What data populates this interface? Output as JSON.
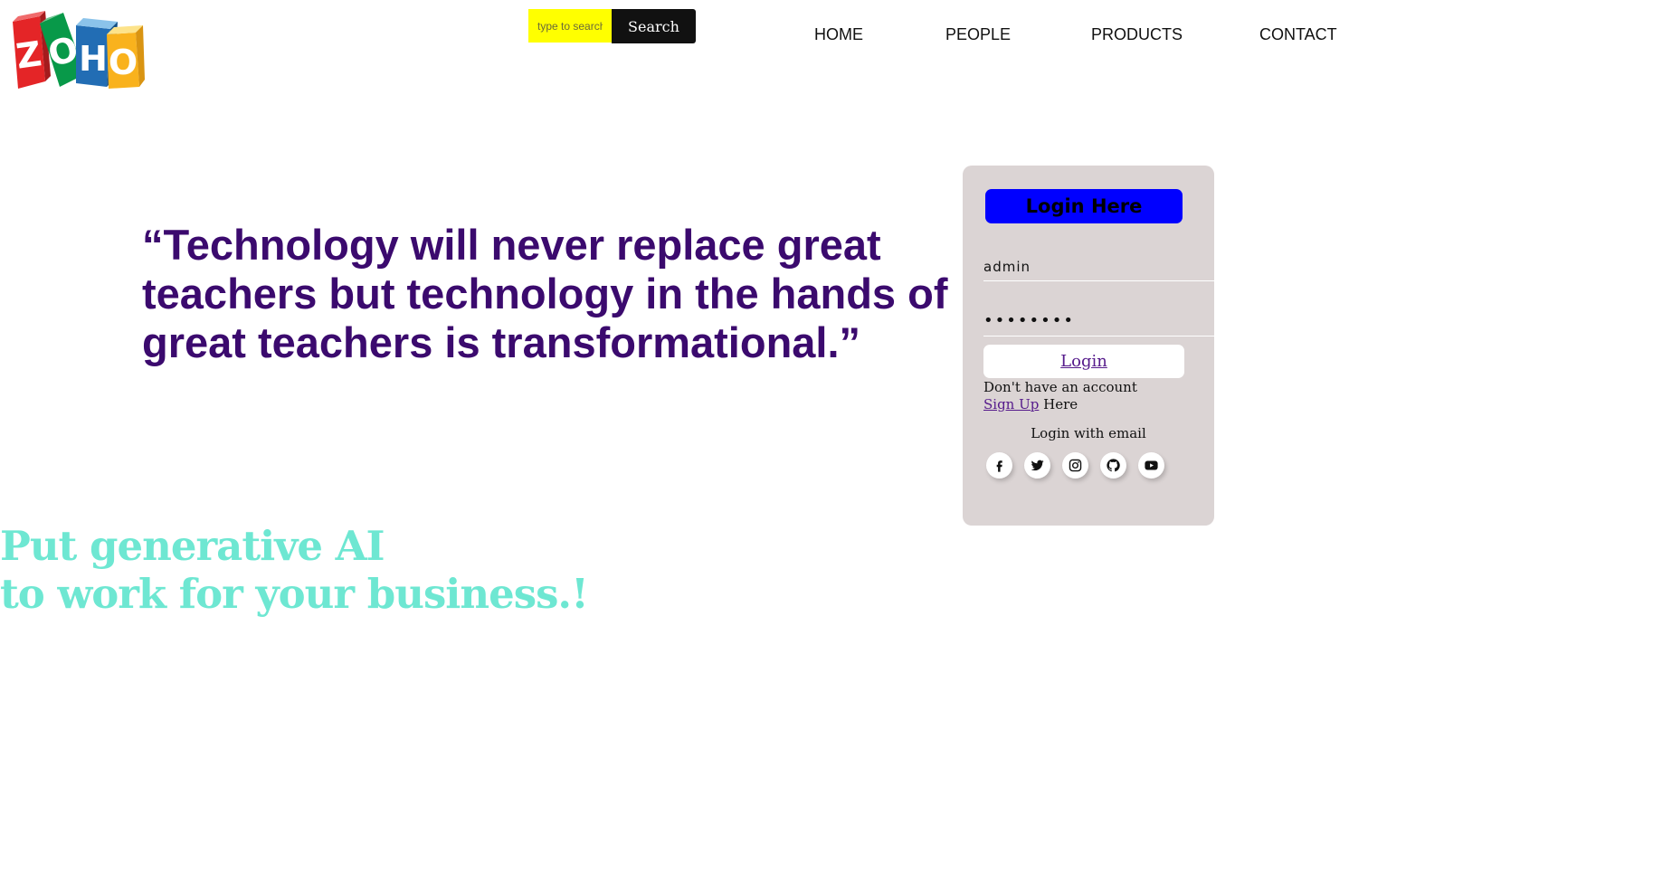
{
  "logo": {
    "letters": [
      "Z",
      "O",
      "H",
      "O"
    ],
    "colors": [
      "#e42527",
      "#089949",
      "#226db4",
      "#f9b21d"
    ]
  },
  "search": {
    "placeholder": "type to search",
    "button_label": "Search"
  },
  "nav": {
    "items": [
      {
        "label": "HOME"
      },
      {
        "label": "PEOPLE"
      },
      {
        "label": "PRODUCTS"
      },
      {
        "label": "CONTACT"
      }
    ]
  },
  "quote": {
    "text": "“Technology will never replace great teachers but technology in the hands of great teachers is transformational.”"
  },
  "tagline": {
    "line1": "Put generative AI",
    "line2": "to work for your business.!"
  },
  "login": {
    "header": "Login Here",
    "username_value": "admin",
    "password_value": "••••••••",
    "login_button": "Login",
    "no_account": "Don't have an account",
    "signup_link": "Sign Up",
    "signup_suffix": " Here",
    "login_with": "Login with email",
    "socials": [
      {
        "icon": "facebook-icon"
      },
      {
        "icon": "twitter-icon"
      },
      {
        "icon": "instagram-icon"
      },
      {
        "icon": "github-icon"
      },
      {
        "icon": "youtube-icon"
      }
    ]
  },
  "colors": {
    "quote": "#3b0a6e",
    "tagline": "#6ee7d2",
    "search_input_bg": "#ffff00",
    "search_button_bg": "#111111",
    "login_panel_bg": "#dbd4d4",
    "login_header_bg": "#0000ff",
    "link": "#551a8b"
  }
}
